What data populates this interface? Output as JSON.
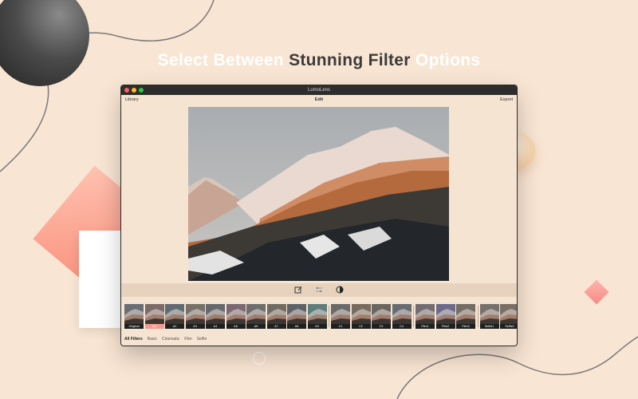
{
  "headline": {
    "part1": "Select Between",
    "part2": "Stunning Filter",
    "part3": "Options"
  },
  "window": {
    "title": "LumoLens",
    "menu": {
      "library": "Library",
      "edit": "Edit",
      "export": "Export"
    },
    "tools": [
      "edit-icon",
      "adjust-icon",
      "filter-icon"
    ],
    "filters": [
      {
        "label": "Original",
        "tone": "#6a6e73",
        "selected": false
      },
      {
        "label": "A1",
        "tone": "#7a6a6a",
        "selected": true
      },
      {
        "label": "A2",
        "tone": "#5f6a72",
        "selected": false
      },
      {
        "label": "A3",
        "tone": "#77716a",
        "selected": false
      },
      {
        "label": "A4",
        "tone": "#66686c",
        "selected": false
      },
      {
        "label": "A5",
        "tone": "#7b6872",
        "selected": false
      },
      {
        "label": "A6",
        "tone": "#6d6d6d",
        "selected": false
      },
      {
        "label": "A7",
        "tone": "#6f6a62",
        "selected": false
      },
      {
        "label": "A8",
        "tone": "#5e6266",
        "selected": false
      },
      {
        "label": "A9",
        "tone": "#5f7d7c",
        "selected": false
      },
      {
        "label": "C1",
        "tone": "#6a6a6a",
        "selected": false
      },
      {
        "label": "C2",
        "tone": "#776a5e",
        "selected": false
      },
      {
        "label": "C3",
        "tone": "#6b6560",
        "selected": false
      },
      {
        "label": "C4",
        "tone": "#676c70",
        "selected": false
      },
      {
        "label": "Film1",
        "tone": "#726c70",
        "selected": false
      },
      {
        "label": "Film2",
        "tone": "#6c6a88",
        "selected": false
      },
      {
        "label": "Film3",
        "tone": "#756c66",
        "selected": false
      },
      {
        "label": "Selfie1",
        "tone": "#77706b",
        "selected": false
      },
      {
        "label": "Selfie2",
        "tone": "#7a6e66",
        "selected": false
      }
    ],
    "categories": [
      {
        "label": "All Filters",
        "active": true
      },
      {
        "label": "Basic",
        "active": false
      },
      {
        "label": "Cinematic",
        "active": false
      },
      {
        "label": "Film",
        "active": false
      },
      {
        "label": "Selfie",
        "active": false
      }
    ]
  },
  "colors": {
    "background": "#f9e5d3",
    "accent_pink": "#f19b93",
    "headline_dark": "#3b3b3b"
  }
}
